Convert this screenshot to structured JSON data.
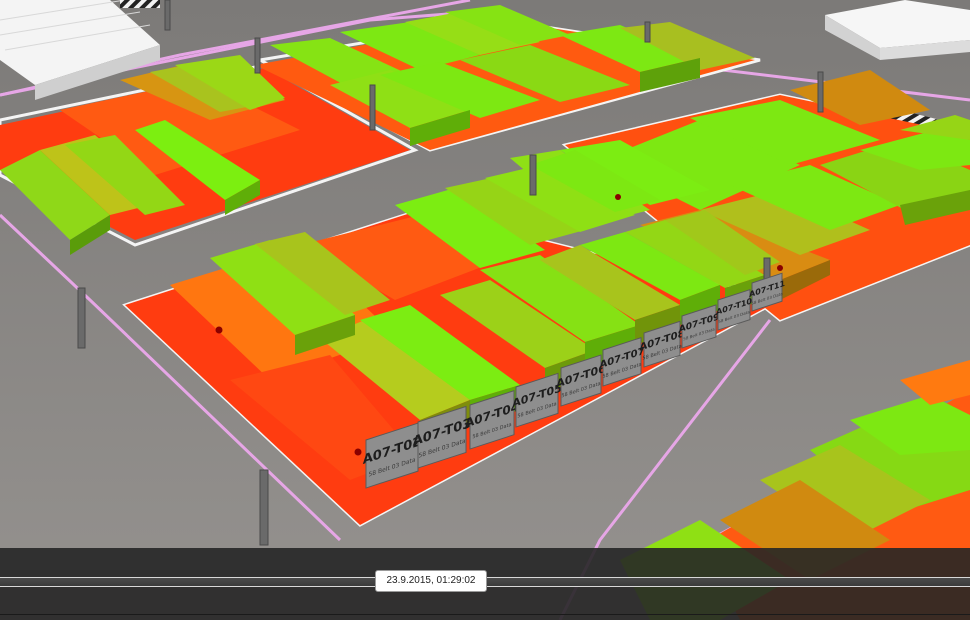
{
  "viewer": {
    "scene_name": "warehouse-3d-view",
    "yard_labels": [
      "A07-T02",
      "A07-T03",
      "A07-T04",
      "A07-T05",
      "A07-T06",
      "A07-T07",
      "A07-T08",
      "A07-T09",
      "A07-T10",
      "A07-T11"
    ],
    "label_subtext": "58 Belt 03 Data"
  },
  "timeline": {
    "timestamp": "23.9.2015, 01:29:02"
  },
  "colors": {
    "ground": "#8a8785",
    "floor_red": "#ff3a10",
    "floor_orange": "#ff7a10",
    "bin_green": "#7dea10",
    "bin_olive": "#a8c020",
    "bin_amber": "#d08a10",
    "lane_line": "#e8a8e8"
  }
}
